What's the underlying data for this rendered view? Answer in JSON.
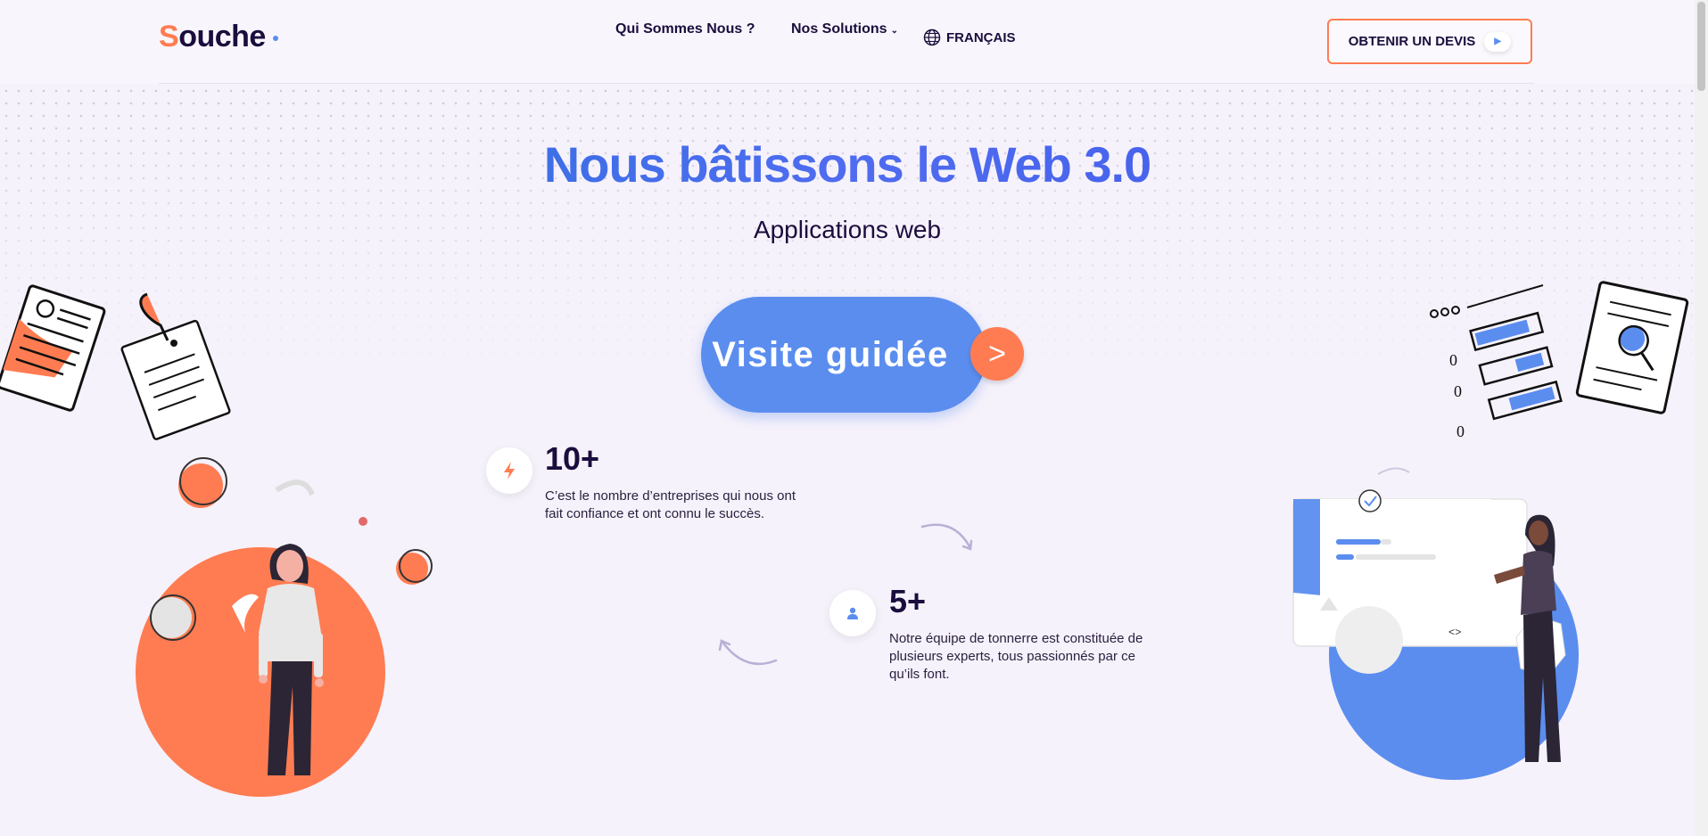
{
  "header": {
    "logo_first": "S",
    "logo_rest": "ouche",
    "nav": {
      "about": "Qui Sommes Nous ?",
      "solutions": "Nos Solutions",
      "language": "FRANÇAIS"
    },
    "cta_label": "OBTENIR UN DEVIS"
  },
  "hero": {
    "title": "Nous bâtissons le Web 3.0",
    "subtitle": "Applications web",
    "tour_label": "Visite guidée",
    "tour_arrow": ">"
  },
  "stats": [
    {
      "value": "10+",
      "text": "C’est le nombre d’entreprises qui nous ont fait confiance et ont connu le succès.",
      "icon": "lightning-icon"
    },
    {
      "value": "5+",
      "text": "Notre équipe de tonnerre est constituée de plusieurs experts, tous passionnés par ce qu’ils font.",
      "icon": "user-icon"
    }
  ],
  "colors": {
    "accent_orange": "#ff7c52",
    "accent_blue": "#5b8def",
    "text_dark": "#1b0d3d",
    "background": "#f6f2fb"
  }
}
